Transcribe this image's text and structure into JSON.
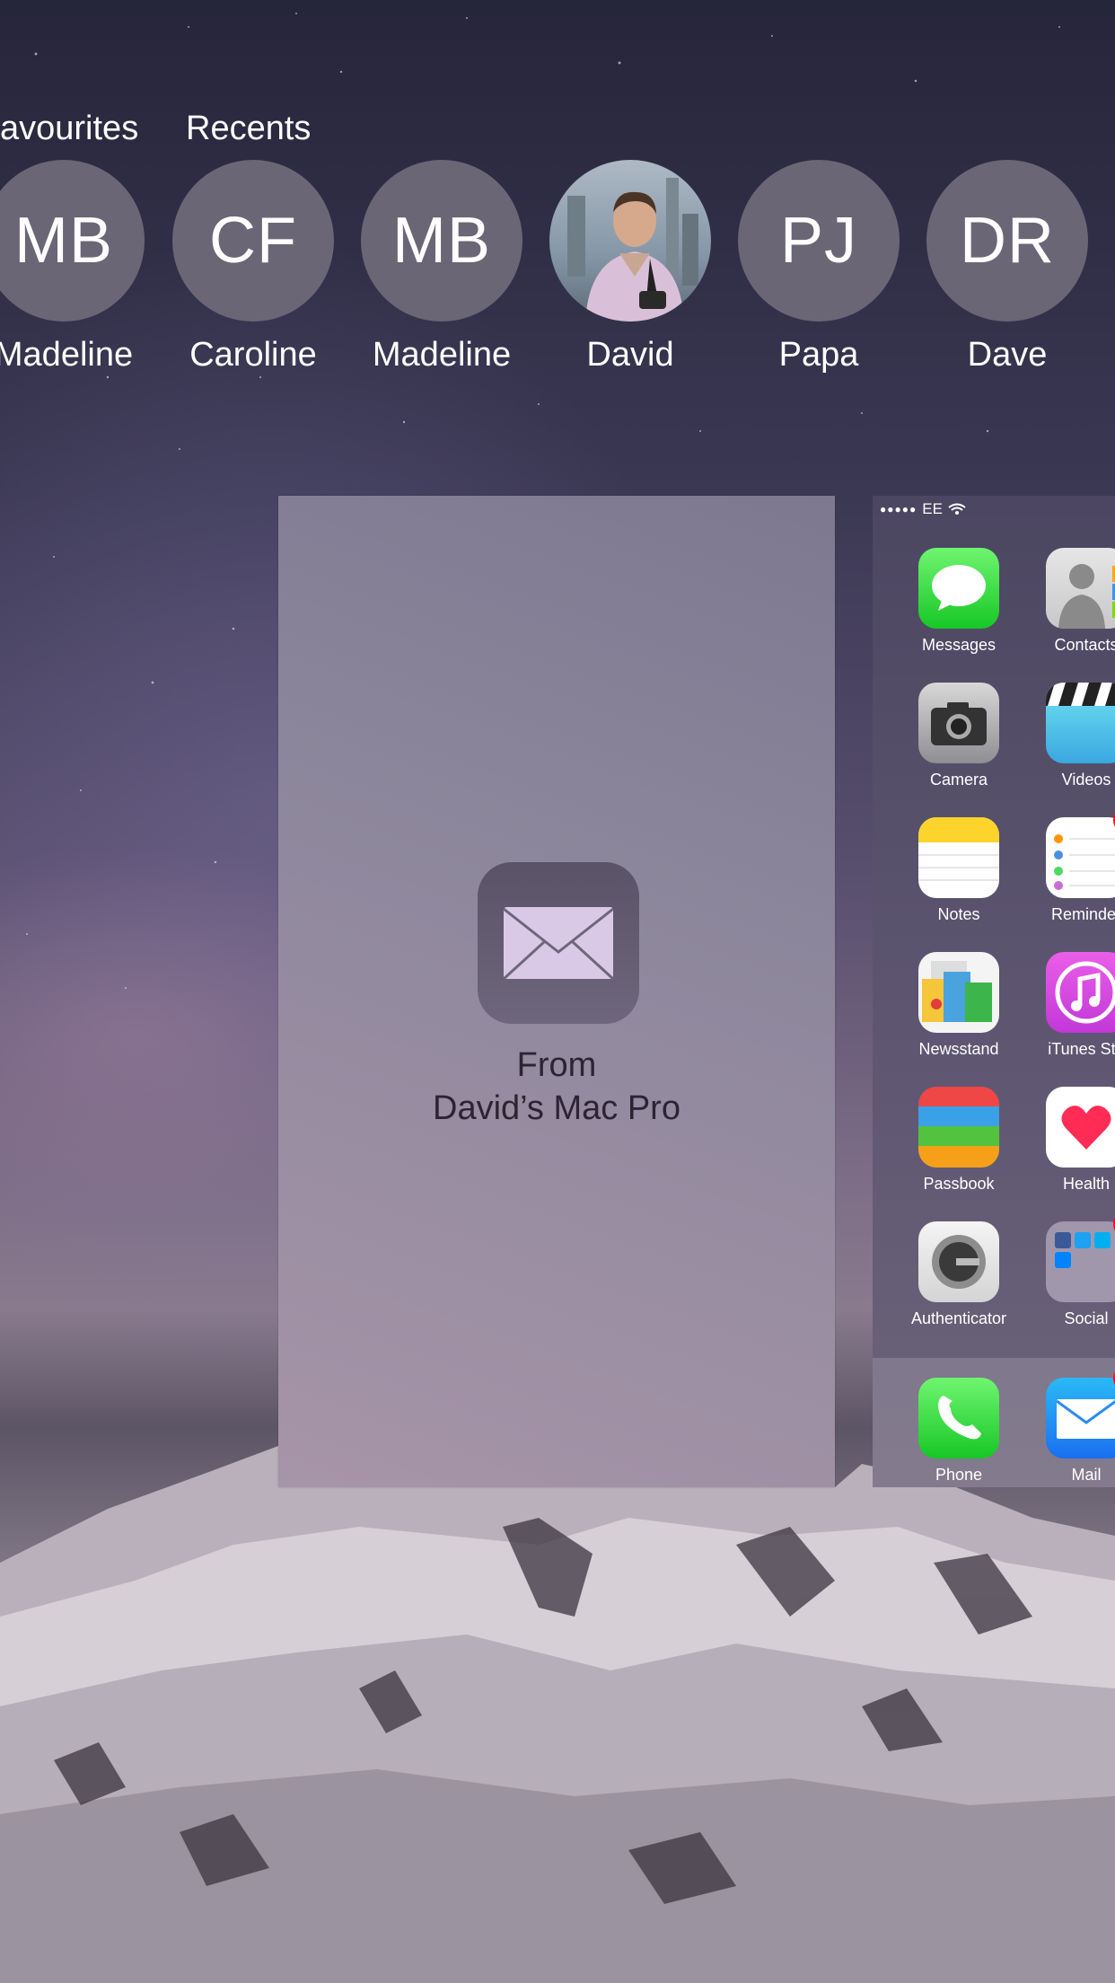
{
  "favourites_label": "avourites",
  "recents_label": "Recents",
  "contacts": [
    {
      "initials": "MB",
      "name": "Madeline"
    },
    {
      "initials": "CF",
      "name": "Caroline"
    },
    {
      "initials": "MB",
      "name": "Madeline"
    },
    {
      "initials": "",
      "name": "David",
      "has_photo": true
    },
    {
      "initials": "PJ",
      "name": "Papa"
    },
    {
      "initials": "DR",
      "name": "Dave"
    }
  ],
  "handoff": {
    "icon": "mail-icon",
    "line1": "From",
    "line2": "David’s Mac Pro"
  },
  "home_screen": {
    "status": {
      "carrier": "EE",
      "signal_dots": "●●●●●"
    },
    "apps": [
      {
        "label": "Messages",
        "icon": "messages-icon"
      },
      {
        "label": "Contacts",
        "icon": "contacts-icon"
      },
      {
        "label": "Camera",
        "icon": "camera-icon"
      },
      {
        "label": "Videos",
        "icon": "videos-icon"
      },
      {
        "label": "Notes",
        "icon": "notes-icon"
      },
      {
        "label": "Reminder",
        "icon": "reminders-icon"
      },
      {
        "label": "Newsstand",
        "icon": "newsstand-icon"
      },
      {
        "label": "iTunes Sto",
        "icon": "itunes-store-icon"
      },
      {
        "label": "Passbook",
        "icon": "passbook-icon"
      },
      {
        "label": "Health",
        "icon": "health-icon"
      },
      {
        "label": "Authenticator",
        "icon": "authenticator-icon"
      },
      {
        "label": "Social",
        "icon": "social-folder-icon"
      }
    ],
    "dock": [
      {
        "label": "Phone",
        "icon": "phone-icon"
      },
      {
        "label": "Mail",
        "icon": "mail-icon"
      }
    ]
  },
  "colors": {
    "avatar_bg": "#6a6676",
    "handoff_card": "#8d879c",
    "badge": "#e8151c"
  }
}
